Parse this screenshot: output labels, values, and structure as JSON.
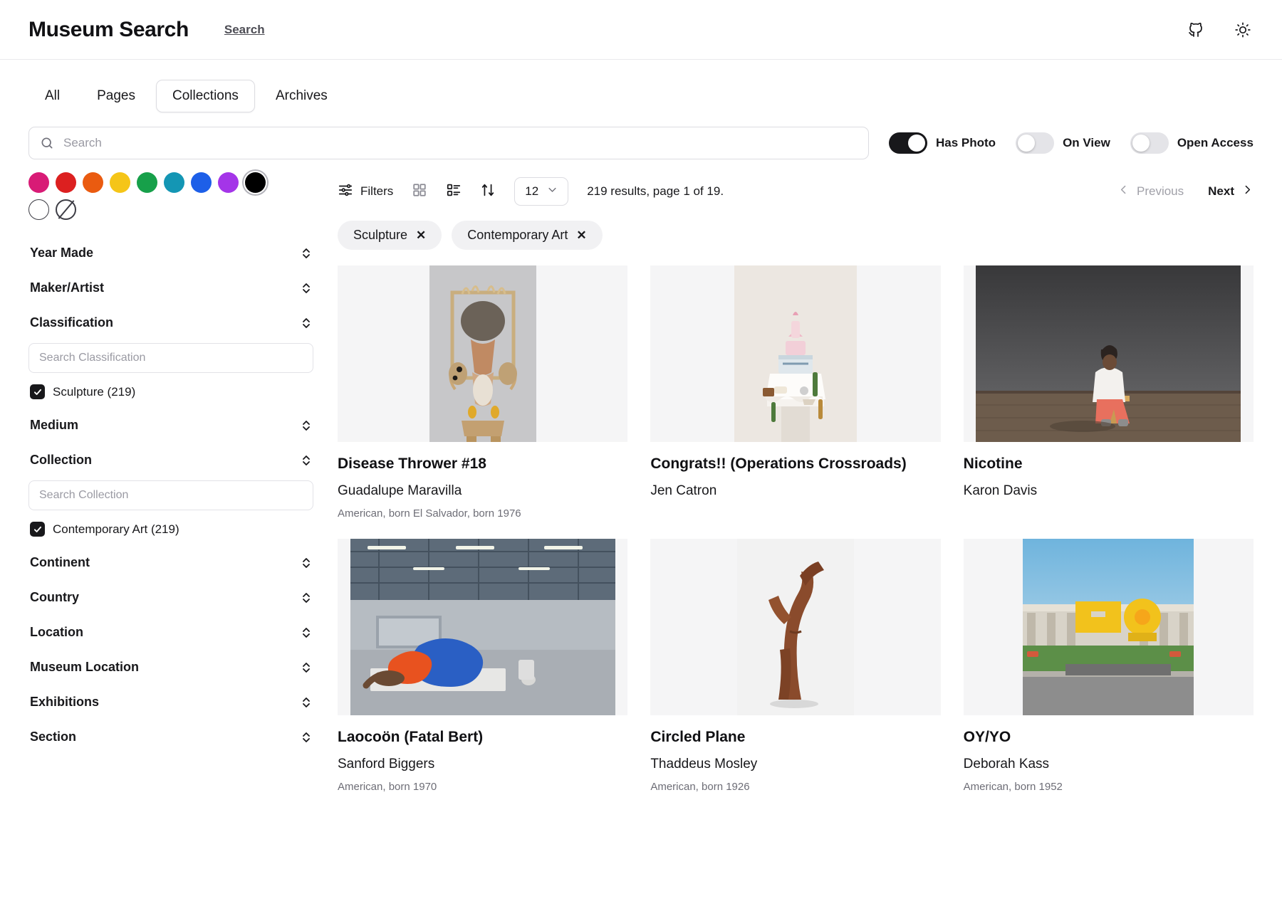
{
  "header": {
    "brand": "Museum Search",
    "nav_link": "Search",
    "github_icon": "github-icon",
    "theme_icon": "sun-icon"
  },
  "tabs": [
    {
      "label": "All",
      "active": false
    },
    {
      "label": "Pages",
      "active": false
    },
    {
      "label": "Collections",
      "active": true
    },
    {
      "label": "Archives",
      "active": false
    }
  ],
  "search": {
    "placeholder": "Search",
    "value": "",
    "icon": "search-icon"
  },
  "toggles": [
    {
      "label": "Has Photo",
      "on": true
    },
    {
      "label": "On View",
      "on": false
    },
    {
      "label": "Open Access",
      "on": false
    }
  ],
  "colors": {
    "swatches": [
      {
        "name": "pink",
        "hex": "#d81b76"
      },
      {
        "name": "red",
        "hex": "#dc2020"
      },
      {
        "name": "orange",
        "hex": "#ea5b10"
      },
      {
        "name": "yellow",
        "hex": "#f5c518"
      },
      {
        "name": "green",
        "hex": "#17a04a"
      },
      {
        "name": "teal",
        "hex": "#1496b4"
      },
      {
        "name": "blue",
        "hex": "#1d5fe8"
      },
      {
        "name": "purple",
        "hex": "#a435e8"
      },
      {
        "name": "black",
        "hex": "#000000",
        "selected": true
      },
      {
        "name": "white",
        "hex": "#ffffff",
        "outline": true
      },
      {
        "name": "no-color",
        "hex": "#ffffff",
        "none": true
      }
    ]
  },
  "facets": [
    {
      "label": "Year Made",
      "type": "collapsible"
    },
    {
      "label": "Maker/Artist",
      "type": "collapsible"
    },
    {
      "label": "Classification",
      "type": "expanded",
      "search_placeholder": "Search Classification",
      "options": [
        {
          "label": "Sculpture (219)",
          "checked": true
        }
      ]
    },
    {
      "label": "Medium",
      "type": "collapsible"
    },
    {
      "label": "Collection",
      "type": "expanded",
      "search_placeholder": "Search Collection",
      "options": [
        {
          "label": "Contemporary Art (219)",
          "checked": true
        }
      ]
    },
    {
      "label": "Continent",
      "type": "collapsible"
    },
    {
      "label": "Country",
      "type": "collapsible"
    },
    {
      "label": "Location",
      "type": "collapsible"
    },
    {
      "label": "Museum Location",
      "type": "collapsible"
    },
    {
      "label": "Exhibitions",
      "type": "collapsible"
    },
    {
      "label": "Section",
      "type": "collapsible"
    }
  ],
  "toolbar": {
    "filters_label": "Filters",
    "filters_icon": "sliders-icon",
    "grid_view_icon": "grid-view-icon",
    "list_view_icon": "list-view-icon",
    "sort_icon": "sort-arrows-icon",
    "per_page_value": "12",
    "per_page_caret": "chevron-down-icon",
    "results_text": "219 results, page 1 of 19.",
    "previous_label": "Previous",
    "next_label": "Next",
    "previous_enabled": false,
    "next_enabled": true
  },
  "active_filters": [
    {
      "label": "Sculpture",
      "remove": "✕"
    },
    {
      "label": "Contemporary Art",
      "remove": "✕"
    }
  ],
  "results": [
    {
      "title": "Disease Thrower #18",
      "artist": "Guadalupe Maravilla",
      "bio": "American, born El Salvador, born 1976",
      "thumb": {
        "style": "tall-object",
        "bg": "#c7c7c9"
      }
    },
    {
      "title": "Congrats!! (Operations Crossroads)",
      "artist": "Jen Catron",
      "bio": "",
      "thumb": {
        "style": "cake-table",
        "bg": "#ece7e1"
      }
    },
    {
      "title": "Nicotine",
      "artist": "Karon Davis",
      "bio": "",
      "thumb": {
        "style": "gallery-figure",
        "bg": "#5a5a5c"
      }
    },
    {
      "title": "Laocoön (Fatal Bert)",
      "artist": "Sanford Biggers",
      "bio": "American, born 1970",
      "thumb": {
        "style": "warehouse-figure",
        "bg": "#8f9aa6"
      }
    },
    {
      "title": "Circled Plane",
      "artist": "Thaddeus Mosley",
      "bio": "American, born 1926",
      "thumb": {
        "style": "wood-sculpture",
        "bg": "#f2f2f2"
      }
    },
    {
      "title": "OY/YO",
      "artist": "Deborah Kass",
      "bio": "American, born 1952",
      "thumb": {
        "style": "yellow-letters",
        "bg": "#9ec4de"
      }
    }
  ]
}
